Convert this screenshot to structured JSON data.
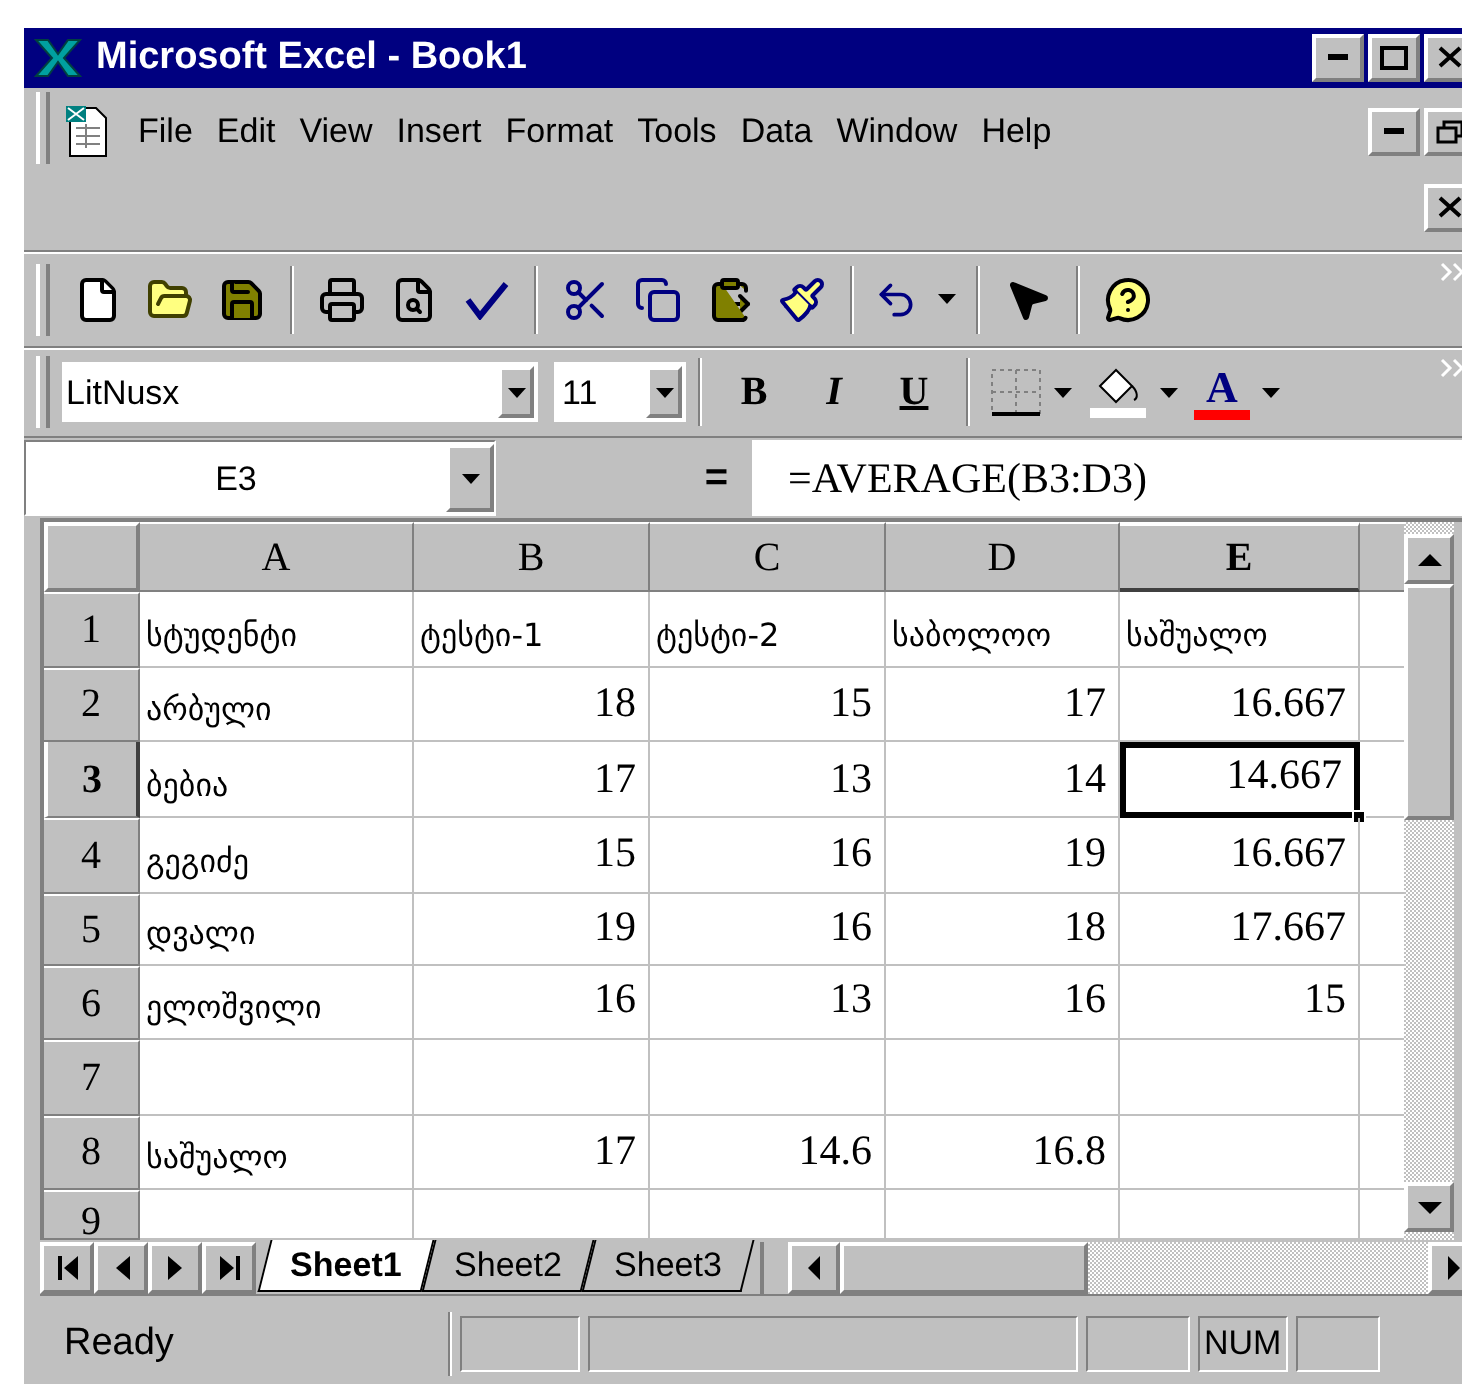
{
  "window": {
    "title": "Microsoft Excel - Book1"
  },
  "menu": [
    "File",
    "Edit",
    "View",
    "Insert",
    "Format",
    "Tools",
    "Data",
    "Window",
    "Help"
  ],
  "format_toolbar": {
    "font": "LitNusx",
    "size": "11",
    "bold": "B",
    "italic": "I",
    "underline": "U",
    "font_color": "A"
  },
  "formula_bar": {
    "name_box": "E3",
    "equals": "=",
    "formula": "=AVERAGE(B3:D3)"
  },
  "sheet": {
    "columns": [
      {
        "label": "A",
        "selected": false
      },
      {
        "label": "B",
        "selected": false
      },
      {
        "label": "C",
        "selected": false
      },
      {
        "label": "D",
        "selected": false
      },
      {
        "label": "E",
        "selected": true
      }
    ],
    "rows": [
      {
        "label": "1",
        "selected": false,
        "cells": [
          {
            "value": "სტუდენტი",
            "kind": "text",
            "selected": false
          },
          {
            "value": "ტესტი-1",
            "kind": "text",
            "selected": false
          },
          {
            "value": "ტესტი-2",
            "kind": "text",
            "selected": false
          },
          {
            "value": "საბოლოო",
            "kind": "text",
            "selected": false
          },
          {
            "value": "საშუალო",
            "kind": "text",
            "selected": false
          }
        ]
      },
      {
        "label": "2",
        "selected": false,
        "cells": [
          {
            "value": "არბული",
            "kind": "text",
            "selected": false
          },
          {
            "value": "18",
            "kind": "number",
            "selected": false
          },
          {
            "value": "15",
            "kind": "number",
            "selected": false
          },
          {
            "value": "17",
            "kind": "number",
            "selected": false
          },
          {
            "value": "16.667",
            "kind": "number",
            "selected": false
          }
        ]
      },
      {
        "label": "3",
        "selected": true,
        "cells": [
          {
            "value": "ბებია",
            "kind": "text",
            "selected": false
          },
          {
            "value": "17",
            "kind": "number",
            "selected": false
          },
          {
            "value": "13",
            "kind": "number",
            "selected": false
          },
          {
            "value": "14",
            "kind": "number",
            "selected": false
          },
          {
            "value": "14.667",
            "kind": "number",
            "selected": true
          }
        ]
      },
      {
        "label": "4",
        "selected": false,
        "cells": [
          {
            "value": "გეგიძე",
            "kind": "text",
            "selected": false
          },
          {
            "value": "15",
            "kind": "number",
            "selected": false
          },
          {
            "value": "16",
            "kind": "number",
            "selected": false
          },
          {
            "value": "19",
            "kind": "number",
            "selected": false
          },
          {
            "value": "16.667",
            "kind": "number",
            "selected": false
          }
        ]
      },
      {
        "label": "5",
        "selected": false,
        "cells": [
          {
            "value": "დვალი",
            "kind": "text",
            "selected": false
          },
          {
            "value": "19",
            "kind": "number",
            "selected": false
          },
          {
            "value": "16",
            "kind": "number",
            "selected": false
          },
          {
            "value": "18",
            "kind": "number",
            "selected": false
          },
          {
            "value": "17.667",
            "kind": "number",
            "selected": false
          }
        ]
      },
      {
        "label": "6",
        "selected": false,
        "cells": [
          {
            "value": "ელოშვილი",
            "kind": "text",
            "selected": false
          },
          {
            "value": "16",
            "kind": "number",
            "selected": false
          },
          {
            "value": "13",
            "kind": "number",
            "selected": false
          },
          {
            "value": "16",
            "kind": "number",
            "selected": false
          },
          {
            "value": "15",
            "kind": "number",
            "selected": false
          }
        ]
      },
      {
        "label": "7",
        "selected": false,
        "cells": []
      },
      {
        "label": "8",
        "selected": false,
        "cells": [
          {
            "value": "საშუალო",
            "kind": "text",
            "selected": false
          },
          {
            "value": "17",
            "kind": "number",
            "selected": false
          },
          {
            "value": "14.6",
            "kind": "number",
            "selected": false
          },
          {
            "value": "16.8",
            "kind": "number",
            "selected": false
          }
        ]
      },
      {
        "label": "9",
        "selected": false,
        "cells": []
      }
    ]
  },
  "sheet_tabs": [
    {
      "label": "Sheet1",
      "selected": true
    },
    {
      "label": "Sheet2",
      "selected": false
    },
    {
      "label": "Sheet3",
      "selected": false
    }
  ],
  "status_bar": {
    "text": "Ready",
    "indicators": [
      "NUM"
    ]
  }
}
